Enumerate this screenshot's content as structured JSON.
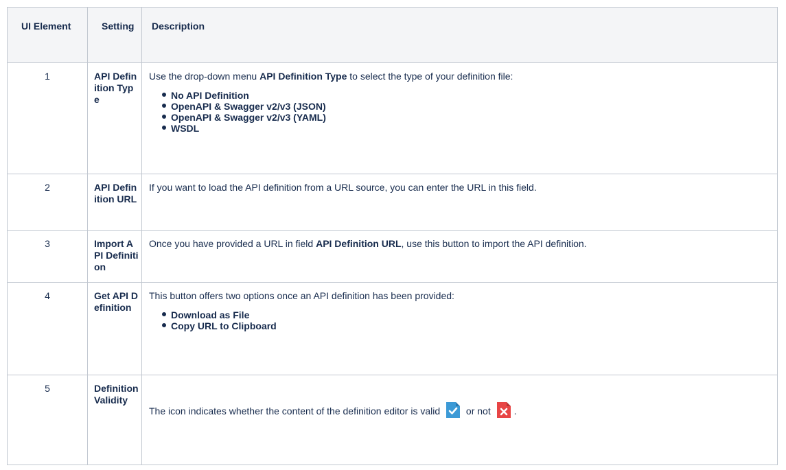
{
  "table": {
    "headers": {
      "ui_element": "UI Element",
      "setting": "Setting",
      "description": "Description"
    },
    "rows": [
      {
        "num": "1",
        "setting": "API Definition Type",
        "desc_pre": "Use the drop-down menu ",
        "desc_bold": "API Definition Type",
        "desc_post": " to select the type of your definition file:",
        "options": [
          "No API Definition",
          "OpenAPI & Swagger v2/v3 (JSON)",
          "OpenAPI & Swagger v2/v3 (YAML)",
          "WSDL"
        ]
      },
      {
        "num": "2",
        "setting": "API Definition URL",
        "desc": "If you want to load the API definition from a URL source, you can enter the URL in this field."
      },
      {
        "num": "3",
        "setting": "Import API Definition",
        "desc_pre": "Once you have provided a URL in field ",
        "desc_bold": "API Definition URL",
        "desc_post": ", use this button to import the API definition."
      },
      {
        "num": "4",
        "setting": "Get API Definition",
        "desc": "This button offers two options once an API definition has been provided:",
        "options": [
          "Download as File",
          "Copy URL to Clipboard"
        ]
      },
      {
        "num": "5",
        "setting": "Definition Validity",
        "desc_pre": "The icon indicates whether the content of the definition editor is valid ",
        "desc_mid": " or not ",
        "desc_post": ".",
        "icons": {
          "valid": "file-valid-icon",
          "invalid": "file-invalid-icon",
          "valid_color": "#3c9ad6",
          "invalid_color": "#e84545"
        }
      }
    ]
  }
}
